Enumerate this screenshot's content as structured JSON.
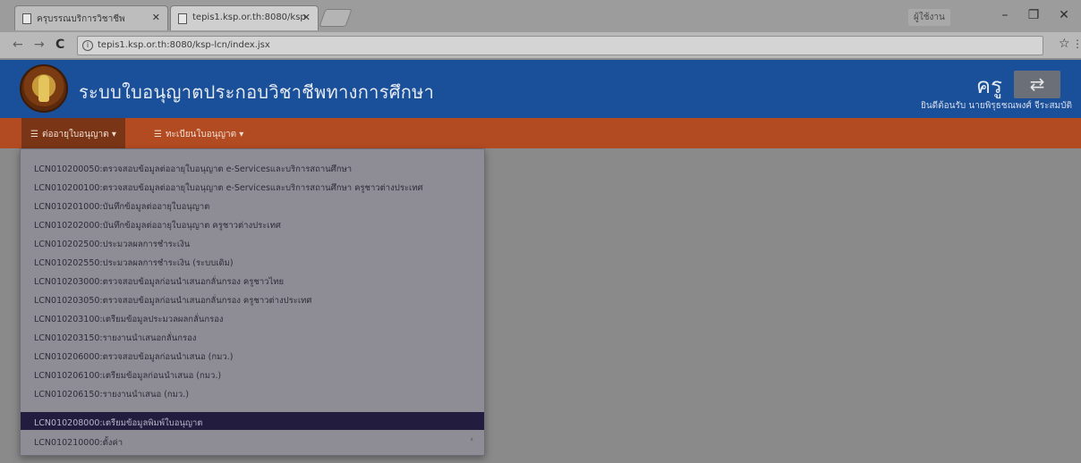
{
  "browser": {
    "tabs": [
      {
        "title": "ครุบรรณบริการวิชาชีพ"
      },
      {
        "title": "tepis1.ksp.or.th:8080/ksp"
      }
    ],
    "window_user": "ผู้ใช้งาน",
    "url": "tepis1.ksp.or.th:8080/ksp-lcn/index.jsx"
  },
  "app": {
    "title": "ระบบใบอนุญาตประกอบวิชาชีพทางการศึกษา",
    "role": "ครู",
    "welcome": "ยินดีต้อนรับ นายพิรุธชณพงศ์ จีระสมบัติ"
  },
  "menubar": {
    "items": [
      {
        "label": "ต่ออายุใบอนุญาต ▾",
        "icon": "list-icon"
      },
      {
        "label": "ทะเบียนใบอนุญาต ▾",
        "icon": "list-icon"
      }
    ]
  },
  "dropdown": {
    "items": [
      {
        "label": "LCN010200050:ตรวจสอบข้อมูลต่ออายุใบอนุญาต e-Servicesและบริการสถานศึกษา"
      },
      {
        "label": "LCN010200100:ตรวจสอบข้อมูลต่ออายุใบอนุญาต e-Servicesและบริการสถานศึกษา ครูชาวต่างประเทศ"
      },
      {
        "label": "LCN010201000:บันทึกข้อมูลต่ออายุใบอนุญาต"
      },
      {
        "label": "LCN010202000:บันทึกข้อมูลต่ออายุใบอนุญาต ครูชาวต่างประเทศ"
      },
      {
        "label": "LCN010202500:ประมวลผลการชำระเงิน"
      },
      {
        "label": "LCN010202550:ประมวลผลการชำระเงิน (ระบบเดิม)"
      },
      {
        "label": "LCN010203000:ตรวจสอบข้อมูลก่อนนำเสนอกลั่นกรอง ครูชาวไทย"
      },
      {
        "label": "LCN010203050:ตรวจสอบข้อมูลก่อนนำเสนอกลั่นกรอง ครูชาวต่างประเทศ"
      },
      {
        "label": "LCN010203100:เตรียมข้อมูลประมวลผลกลั่นกรอง"
      },
      {
        "label": "LCN010203150:รายงานนำเสนอกลั่นกรอง"
      },
      {
        "label": "LCN010206000:ตรวจสอบข้อมูลก่อนนำเสนอ (กมว.)"
      },
      {
        "label": "LCN010206100:เตรียมข้อมูลก่อนนำเสนอ (กมว.)"
      },
      {
        "label": "LCN010206150:รายงานนำเสนอ (กมว.)"
      },
      {
        "label": "LCN010208000:เตรียมข้อมูลพิมพ์ใบอนุญาต",
        "selected": true
      },
      {
        "label": "LCN010210000:ตั้งค่า",
        "has_submenu": true
      }
    ]
  }
}
